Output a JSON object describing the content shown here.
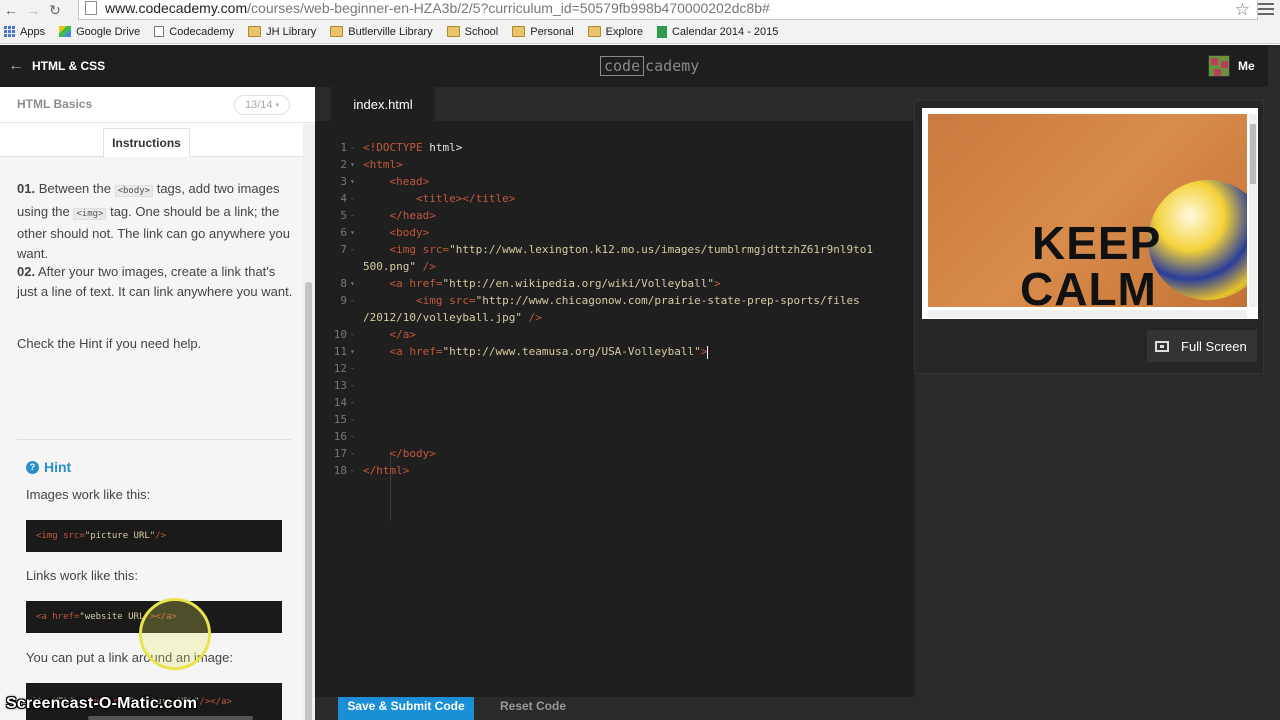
{
  "browser": {
    "url_host": "www.codecademy.com",
    "url_path": "/courses/web-beginner-en-HZA3b/2/5?curriculum_id=50579fb998b470000202dc8b#",
    "bookmarks": [
      {
        "label": "Apps",
        "icon": "apps-icon"
      },
      {
        "label": "Google Drive",
        "icon": "google-drive-icon"
      },
      {
        "label": "Codecademy",
        "icon": "page-icon"
      },
      {
        "label": "JH Library",
        "icon": "folder-icon"
      },
      {
        "label": "Butlerville Library",
        "icon": "folder-icon"
      },
      {
        "label": "School",
        "icon": "folder-icon"
      },
      {
        "label": "Personal",
        "icon": "folder-icon"
      },
      {
        "label": "Explore",
        "icon": "folder-icon"
      },
      {
        "label": "Calendar 2014 - 2015",
        "icon": "sheets-icon"
      }
    ]
  },
  "header": {
    "course": "HTML & CSS",
    "logo_box": "code",
    "logo_rest": "cademy",
    "user": "Me"
  },
  "lesson": {
    "title": "HTML Basics",
    "progress": "13/14",
    "instructions_tab": "Instructions",
    "step1_num": "01.",
    "step1_a": " Between the ",
    "step1_tag1": "<body>",
    "step1_b": " tags, add two images using the ",
    "step1_tag2": "<img>",
    "step1_c": " tag. One should be a link; the other should not. The link can go anywhere you want.",
    "step2_num": "02.",
    "step2_text": " After your two images, create a link that's just a line of text. It can link anywhere you want.",
    "check": "Check the Hint if you need help.",
    "hint_title": "Hint",
    "hint_images": "Images work like this:",
    "hint_code1": [
      "<img src=",
      "\"picture URL\"",
      " />"
    ],
    "hint_links": "Links work like this:",
    "hint_code2": [
      "<a href=",
      "\"website URL\"",
      "></a>"
    ],
    "hint_wrap": "You can put a link around an image:",
    "hint_code3": [
      "site URL\"",
      "><img src=",
      "\"picture URL\"",
      " /></a>"
    ]
  },
  "editor": {
    "tab": "index.html",
    "lines": [
      {
        "n": "1",
        "html": "<span class='tg'>&lt;!DOCTYPE</span><span class='pl'> html&gt;</span>"
      },
      {
        "n": "2",
        "html": "<span class='tg'>&lt;html&gt;</span>"
      },
      {
        "n": "3",
        "html": "    <span class='tg'>&lt;head&gt;</span>"
      },
      {
        "n": "4",
        "html": "        <span class='tg'>&lt;title&gt;&lt;/title&gt;</span>"
      },
      {
        "n": "5",
        "html": "    <span class='tg'>&lt;/head&gt;</span>"
      },
      {
        "n": "6",
        "html": "    <span class='tg'>&lt;body&gt;</span>"
      },
      {
        "n": "7",
        "html": "    <span class='tg'>&lt;img</span> <span class='at'>src=</span><span class='st'>\"http://www.lexington.k12.mo.us/images/tumblrmgjdttzhZ61r9nl9to1</span>"
      },
      {
        "n": "",
        "html": "<span class='st'>500.png\"</span> <span class='tg'>/&gt;</span>"
      },
      {
        "n": "8",
        "html": "    <span class='tg'>&lt;a</span> <span class='at'>href=</span><span class='st'>\"http://en.wikipedia.org/wiki/Volleyball\"</span><span class='tg'>&gt;</span>"
      },
      {
        "n": "9",
        "html": "        <span class='tg'>&lt;img</span> <span class='at'>src=</span><span class='st'>\"http://www.chicagonow.com/prairie-state-prep-sports/files</span>"
      },
      {
        "n": "",
        "html": "<span class='st'>/2012/10/volleyball.jpg\"</span> <span class='tg'>/&gt;</span>"
      },
      {
        "n": "10",
        "html": "    <span class='tg'>&lt;/a&gt;</span>"
      },
      {
        "n": "11",
        "html": "    <span class='tg'>&lt;a</span> <span class='at'>href=</span><span class='st'>\"http://www.teamusa.org/USA-Volleyball\"</span><span class='tg'>&gt;</span><span class='caret'></span>"
      },
      {
        "n": "12",
        "html": ""
      },
      {
        "n": "13",
        "html": ""
      },
      {
        "n": "14",
        "html": ""
      },
      {
        "n": "15",
        "html": ""
      },
      {
        "n": "16",
        "html": ""
      },
      {
        "n": "17",
        "html": "    <span class='tg'>&lt;/body&gt;</span>"
      },
      {
        "n": "18",
        "html": "<span class='tg'>&lt;/html&gt;</span>"
      }
    ],
    "save_label": "Save & Submit Code",
    "reset_label": "Reset Code"
  },
  "preview": {
    "image_text": "KEEP",
    "image_text2": "CALM",
    "fullscreen_label": "Full Screen"
  },
  "watermark": "Screencast-O-Matic.com"
}
